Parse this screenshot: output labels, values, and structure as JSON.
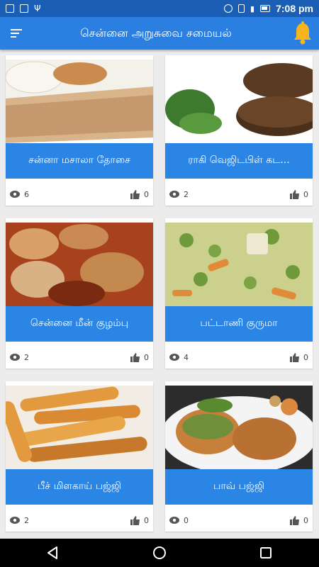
{
  "status_bar": {
    "time": "7:08 pm",
    "icons": [
      "image-icon",
      "gallery-icon",
      "usb-icon",
      "dnd-icon",
      "vibrate-icon",
      "signal-icon",
      "battery-charging-icon"
    ]
  },
  "app_bar": {
    "title": "சென்னை அறுசுவை சமையல்",
    "menu_icon": "menu-icon",
    "notification_icon": "bell-icon"
  },
  "recipes": [
    {
      "name": "சன்னா மசாலா தோசை",
      "views": "6",
      "likes": "0",
      "photo_colors": [
        "#f3f1ea",
        "#c98b4e",
        "#e7d3b6"
      ]
    },
    {
      "name": "ராகி வெஜிடபிள் கட...",
      "views": "2",
      "likes": "0",
      "photo_colors": [
        "#ffffff",
        "#5a3a22",
        "#3e7a2e"
      ]
    },
    {
      "name": "சென்னை மீன் குழம்பு",
      "views": "2",
      "likes": "0",
      "photo_colors": [
        "#a8421e",
        "#d9b184",
        "#7a2a10"
      ]
    },
    {
      "name": "பட்டாணி குருமா",
      "views": "4",
      "likes": "0",
      "photo_colors": [
        "#cbd08c",
        "#6f9a3c",
        "#e18b3a"
      ]
    },
    {
      "name": "பீச் மிளகாய் பஜ்ஜி",
      "views": "2",
      "likes": "0",
      "photo_colors": [
        "#f2ede4",
        "#e39a3e",
        "#c6792b"
      ]
    },
    {
      "name": "பாவ் பஜ்ஜி",
      "views": "0",
      "likes": "0",
      "photo_colors": [
        "#2c2c2c",
        "#c7803a",
        "#6f8f3a"
      ]
    }
  ],
  "nav_bar": {
    "back_icon": "back-icon",
    "home_icon": "home-icon",
    "recents_icon": "recents-icon"
  }
}
